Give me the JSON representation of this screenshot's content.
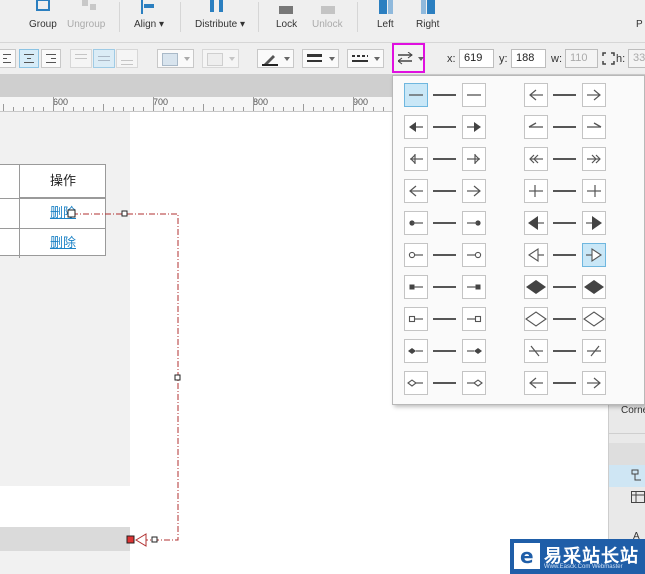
{
  "toolbar": {
    "group": "Group",
    "ungroup": "Ungroup",
    "align": "Align ▾",
    "distribute": "Distribute ▾",
    "lock": "Lock",
    "unlock": "Unlock",
    "left": "Left",
    "right": "Right",
    "extra": "P"
  },
  "format": {
    "x_label": "x:",
    "x_value": "619",
    "y_label": "y:",
    "y_value": "188",
    "w_label": "w:",
    "w_value": "110",
    "h_label": "h:",
    "h_value": "33"
  },
  "ruler": {
    "marks": [
      "600",
      "700",
      "800",
      "900"
    ]
  },
  "table": {
    "header": "操作",
    "rows": [
      "删除",
      "删除"
    ]
  },
  "right_panel": {
    "label": "Corne",
    "item": "A"
  },
  "logo": {
    "title": "易采站长站",
    "sub": "Www.Easck.Com Webmaster"
  },
  "colors": {
    "accent": "#1b82c6",
    "selected": "#c9e7f7",
    "highlight": "#e010e0",
    "connector": "#b03030"
  }
}
